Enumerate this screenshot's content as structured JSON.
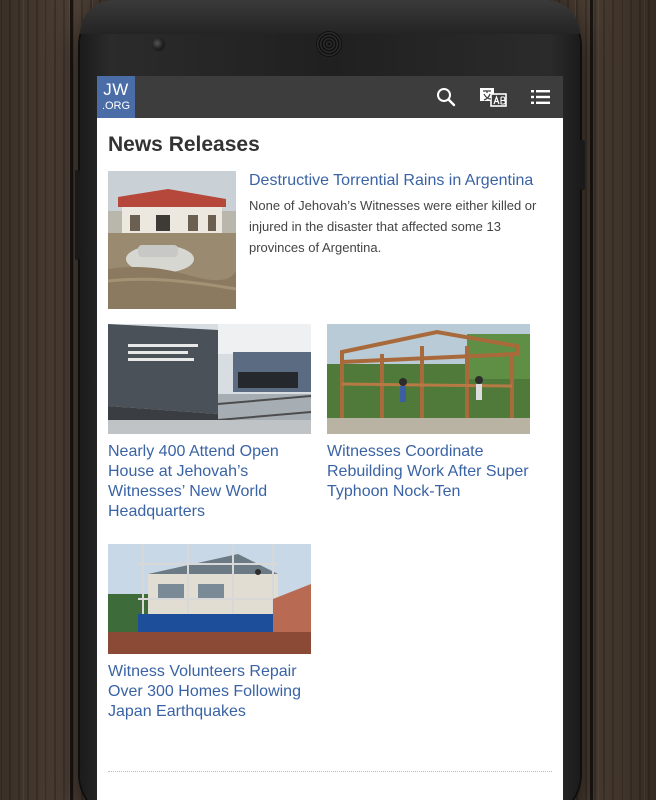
{
  "app": {
    "logo_top": "JW",
    "logo_bottom": ".ORG",
    "icons": [
      "search-icon",
      "language-icon",
      "menu-icon"
    ]
  },
  "colors": {
    "appbar": "#3d3d3d",
    "logo": "#4a6da7",
    "link": "#3a63a5"
  },
  "page": {
    "title": "News Releases"
  },
  "featured": {
    "headline": "Destructive Torrential Rains in Argentina",
    "summary": "None of Jehovah’s Witnesses were either killed or injured in the disaster that affected some 13 provinces of Argentina."
  },
  "articles": [
    {
      "headline": "Nearly 400 Attend Open House at Jehovah’s Witnesses’ New World Headquarters"
    },
    {
      "headline": "Witnesses Coordinate Rebuilding Work After Super Typhoon Nock-Ten"
    },
    {
      "headline": "Witness Volunteers Repair Over 300 Homes Following Japan Earthquakes"
    }
  ]
}
